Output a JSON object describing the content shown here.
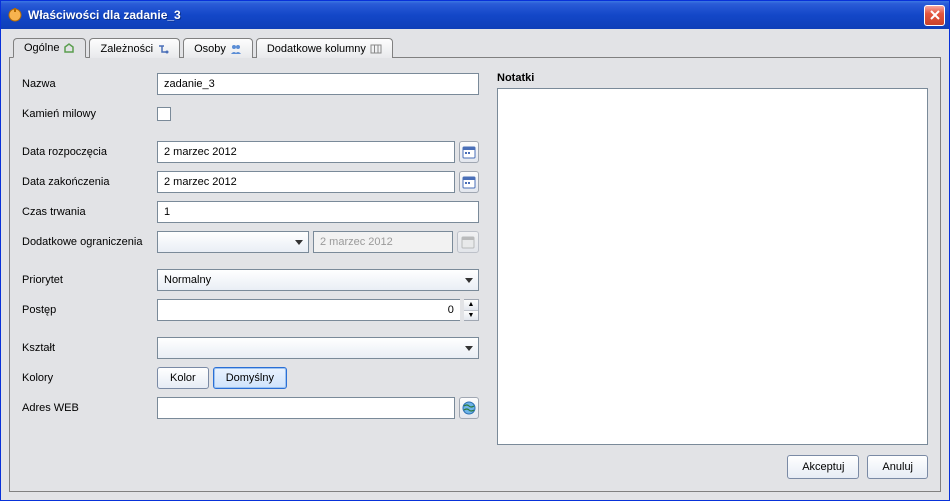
{
  "window": {
    "title": "Właściwości dla zadanie_3"
  },
  "tabs": [
    {
      "label": "Ogólne",
      "active": true,
      "icon": "general-icon"
    },
    {
      "label": "Zależności",
      "active": false,
      "icon": "dependency-icon"
    },
    {
      "label": "Osoby",
      "active": false,
      "icon": "people-icon"
    },
    {
      "label": "Dodatkowe kolumny",
      "active": false,
      "icon": "columns-icon"
    }
  ],
  "labels": {
    "name": "Nazwa",
    "milestone": "Kamień milowy",
    "start_date": "Data rozpoczęcia",
    "end_date": "Data zakończenia",
    "duration": "Czas trwania",
    "constraint": "Dodatkowe ograniczenia",
    "priority": "Priorytet",
    "progress": "Postęp",
    "shape": "Kształt",
    "colors": "Kolory",
    "web": "Adres WEB",
    "notes": "Notatki"
  },
  "values": {
    "name": "zadanie_3",
    "milestone_checked": false,
    "start_date": "2 marzec 2012",
    "end_date": "2 marzec 2012",
    "duration": "1",
    "constraint_select": "",
    "constraint_date": "2 marzec 2012",
    "priority": "Normalny",
    "progress": "0",
    "shape": "",
    "web": "",
    "notes": ""
  },
  "buttons": {
    "color": "Kolor",
    "default": "Domyślny",
    "accept": "Akceptuj",
    "cancel": "Anuluj"
  }
}
